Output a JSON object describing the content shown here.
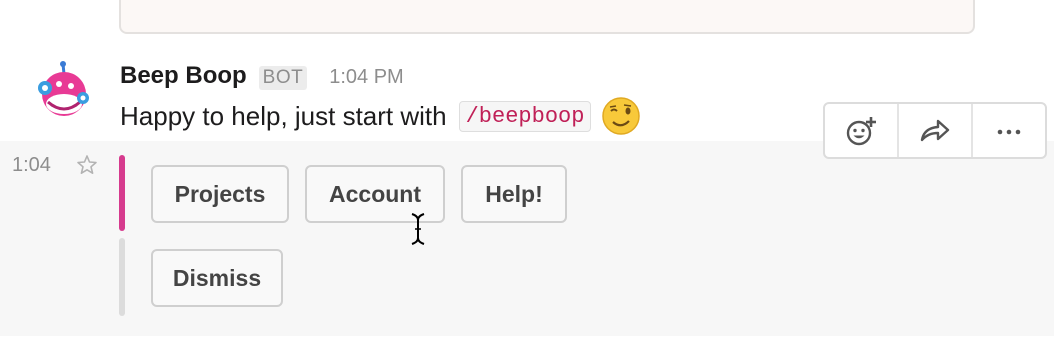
{
  "message": {
    "author": "Beep Boop",
    "badge": "BOT",
    "time": "1:04 PM",
    "text": "Happy to help, just start with",
    "command": "/beepboop",
    "emoji": "winking-face"
  },
  "sidebar": {
    "time": "1:04"
  },
  "actions": {
    "row1": [
      "Projects",
      "Account",
      "Help!"
    ],
    "row2": [
      "Dismiss"
    ],
    "accent_color": "#d63b8e"
  },
  "toolbar": {
    "icons": [
      "add-reaction-icon",
      "share-icon",
      "more-actions-icon"
    ]
  }
}
